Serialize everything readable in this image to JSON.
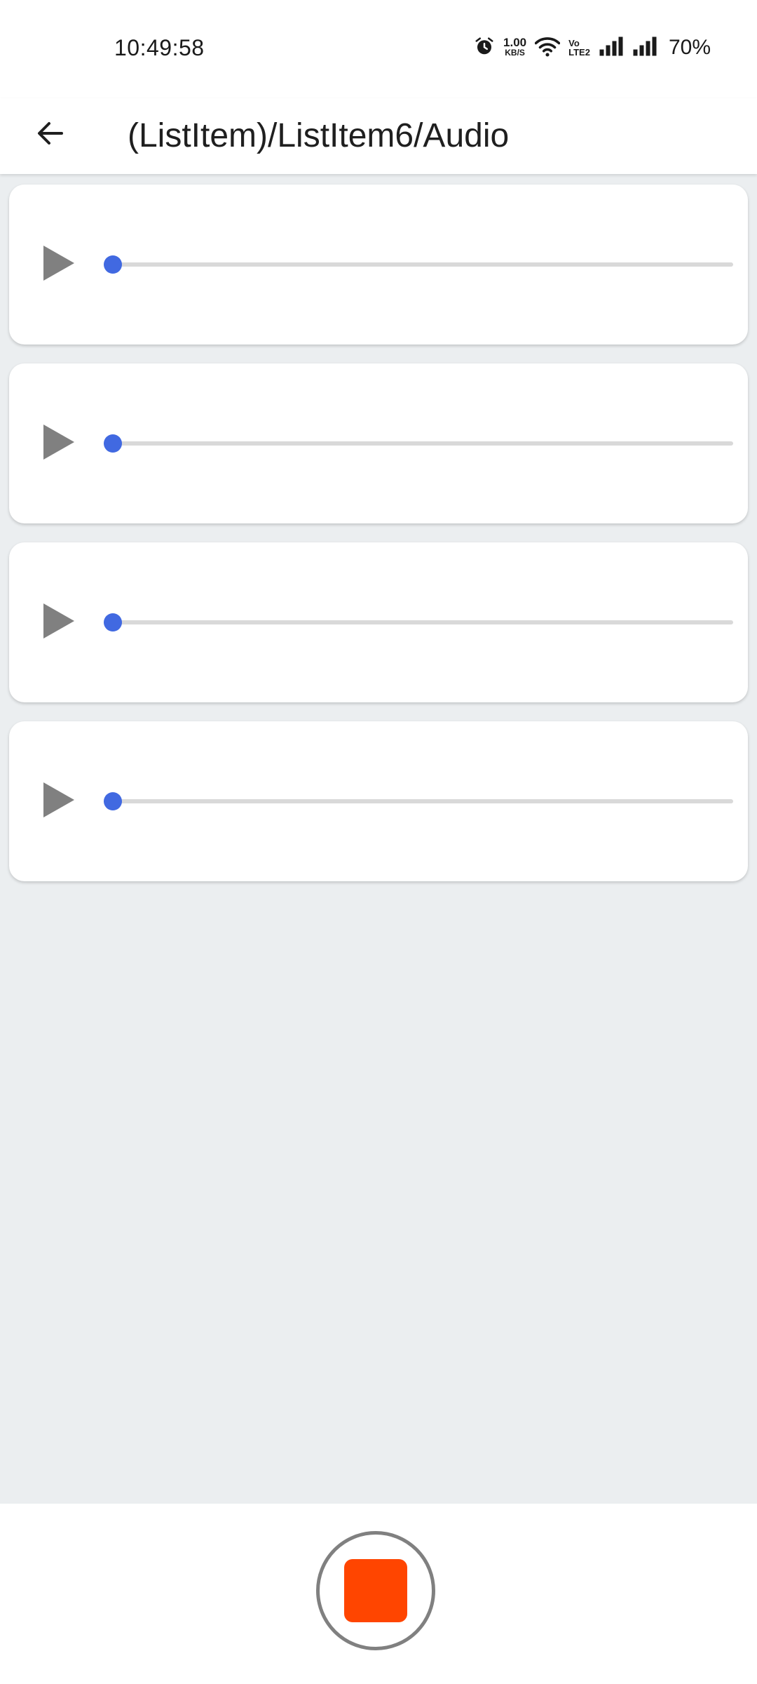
{
  "status_bar": {
    "time": "10:49:58",
    "net_speed_value": "1.00",
    "net_speed_unit": "KB/S",
    "volte_top": "Vo",
    "volte_bottom": "LTE2",
    "battery": "70%",
    "icons": [
      "alarm-icon",
      "wifi-icon",
      "signal-icon",
      "signal-icon"
    ]
  },
  "app_bar": {
    "title": "(ListItem)/ListItem6/Audio",
    "back_icon": "arrow-back-icon"
  },
  "audio_items": [
    {
      "play_icon": "play-icon",
      "progress": 0
    },
    {
      "play_icon": "play-icon",
      "progress": 0
    },
    {
      "play_icon": "play-icon",
      "progress": 0
    },
    {
      "play_icon": "play-icon",
      "progress": 0
    }
  ],
  "record_control": {
    "icon": "stop-icon",
    "stop_color": "#ff4500"
  },
  "colors": {
    "accent": "#4169e1",
    "play_icon": "#808080",
    "track": "#d9d9d9",
    "background": "#ebeef0"
  }
}
